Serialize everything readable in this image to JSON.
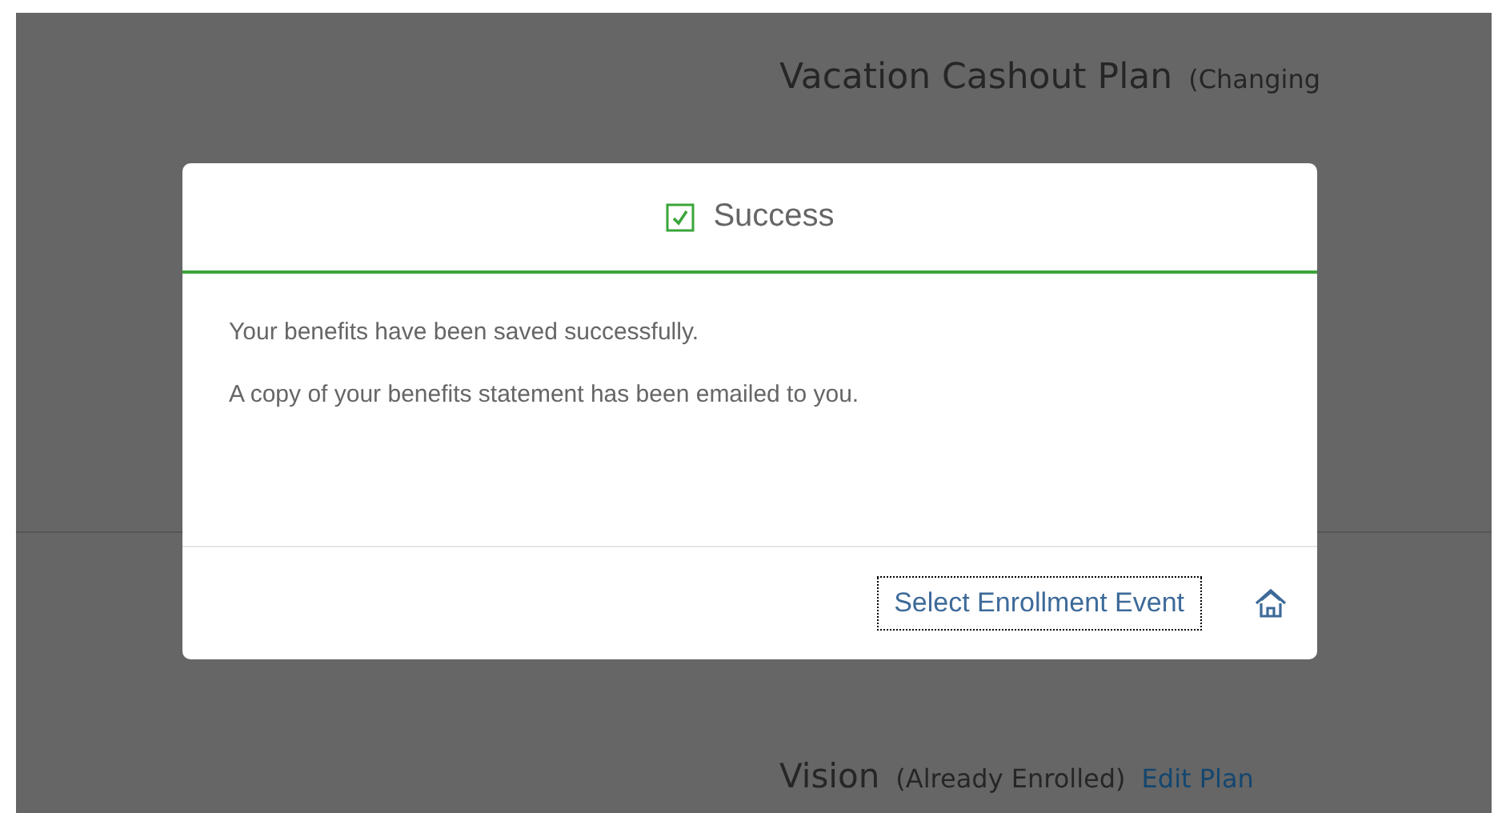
{
  "background": {
    "plans": [
      {
        "name": "Vacation Cashout Plan",
        "status": "(Changing"
      },
      {
        "name": "Vision",
        "status": "(Already Enrolled)",
        "link": "Edit Plan"
      }
    ]
  },
  "dialog": {
    "title": "Success",
    "messages": [
      "Your benefits have been saved successfully.",
      "A copy of your benefits statement has been emailed to you."
    ],
    "action": {
      "label": "Select Enrollment Event",
      "focused": true
    }
  }
}
